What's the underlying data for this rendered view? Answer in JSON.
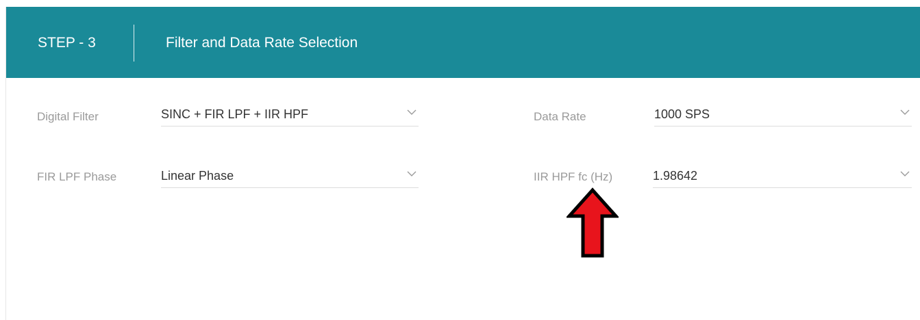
{
  "header": {
    "step_label": "STEP - 3",
    "title": "Filter and Data Rate Selection",
    "background_color": "#1a8a98"
  },
  "fields": {
    "digital_filter": {
      "label": "Digital Filter",
      "value": "SINC + FIR LPF + IIR HPF",
      "icon": "chevron-down-icon"
    },
    "data_rate": {
      "label": "Data Rate",
      "value": "1000 SPS",
      "icon": "chevron-down-icon"
    },
    "fir_lpf_phase": {
      "label": "FIR LPF Phase",
      "value": "Linear Phase",
      "icon": "chevron-down-icon"
    },
    "iir_hpf_fc": {
      "label": "IIR HPF fc (Hz)",
      "value": "1.98642",
      "icon": "chevron-down-icon"
    }
  },
  "annotation": {
    "icon": "arrow-up-icon",
    "color": "#e8141c"
  }
}
